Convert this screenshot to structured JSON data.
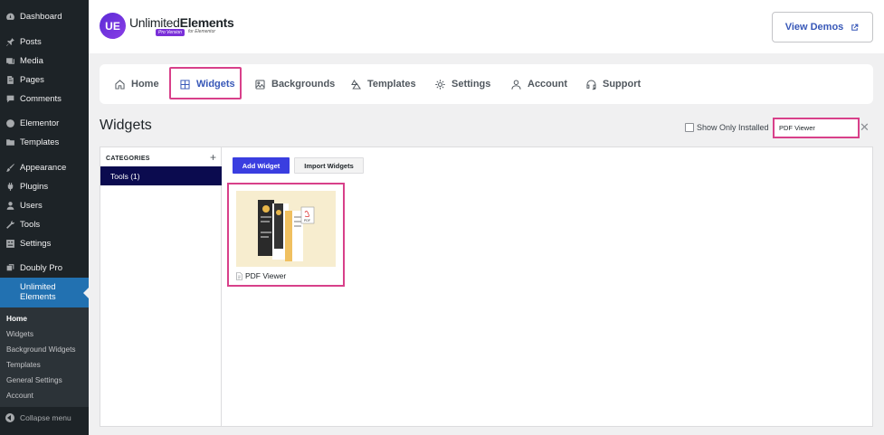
{
  "sidebar": {
    "items": [
      {
        "label": "Dashboard",
        "icon": "dashboard-icon"
      },
      {
        "label": "Posts",
        "icon": "pin-icon"
      },
      {
        "label": "Media",
        "icon": "media-icon"
      },
      {
        "label": "Pages",
        "icon": "pages-icon"
      },
      {
        "label": "Comments",
        "icon": "comment-icon"
      },
      {
        "label": "Elementor",
        "icon": "elementor-icon"
      },
      {
        "label": "Templates",
        "icon": "folder-icon"
      },
      {
        "label": "Appearance",
        "icon": "brush-icon"
      },
      {
        "label": "Plugins",
        "icon": "plug-icon"
      },
      {
        "label": "Users",
        "icon": "user-icon"
      },
      {
        "label": "Tools",
        "icon": "wrench-icon"
      },
      {
        "label": "Settings",
        "icon": "settings-icon"
      },
      {
        "label": "Doubly Pro",
        "icon": "doubly-icon"
      }
    ],
    "active": {
      "label_line1": "Unlimited",
      "label_line2": "Elements",
      "icon": "unlimited-elements-icon"
    },
    "submenu": [
      "Home",
      "Widgets",
      "Background Widgets",
      "Templates",
      "General Settings",
      "Account"
    ],
    "collapse_label": "Collapse menu"
  },
  "header": {
    "logo_word1": "Unlimited",
    "logo_word2": "Elements",
    "logo_badge": "Pro Version",
    "logo_sub": "for Elementor",
    "view_demos": "View Demos"
  },
  "nav": {
    "tabs": [
      {
        "label": "Home",
        "icon": "home-icon"
      },
      {
        "label": "Widgets",
        "icon": "grid-icon"
      },
      {
        "label": "Backgrounds",
        "icon": "image-icon"
      },
      {
        "label": "Templates",
        "icon": "templates-icon"
      },
      {
        "label": "Settings",
        "icon": "gear-icon"
      },
      {
        "label": "Account",
        "icon": "account-icon"
      },
      {
        "label": "Support",
        "icon": "headset-icon"
      }
    ],
    "active_tab": "Widgets"
  },
  "main": {
    "title": "Widgets",
    "show_only_installed": "Show Only Installed",
    "show_only_checked": false,
    "search_value": "PDF Viewer",
    "categories_header": "CATEGORIES",
    "categories": [
      {
        "label": "Tools (1)",
        "selected": true
      }
    ],
    "add_widget": "Add Widget",
    "import_widgets": "Import Widgets",
    "widgets": [
      {
        "name": "PDF Viewer",
        "icon": "document-icon"
      }
    ]
  },
  "colors": {
    "accent": "#3858b8",
    "highlight": "#d8408a",
    "sidebar_bg": "#1d2327",
    "sidebar_active": "#2271b1",
    "category_selected": "#0b0b4f",
    "primary_button": "#3a3ee0"
  }
}
